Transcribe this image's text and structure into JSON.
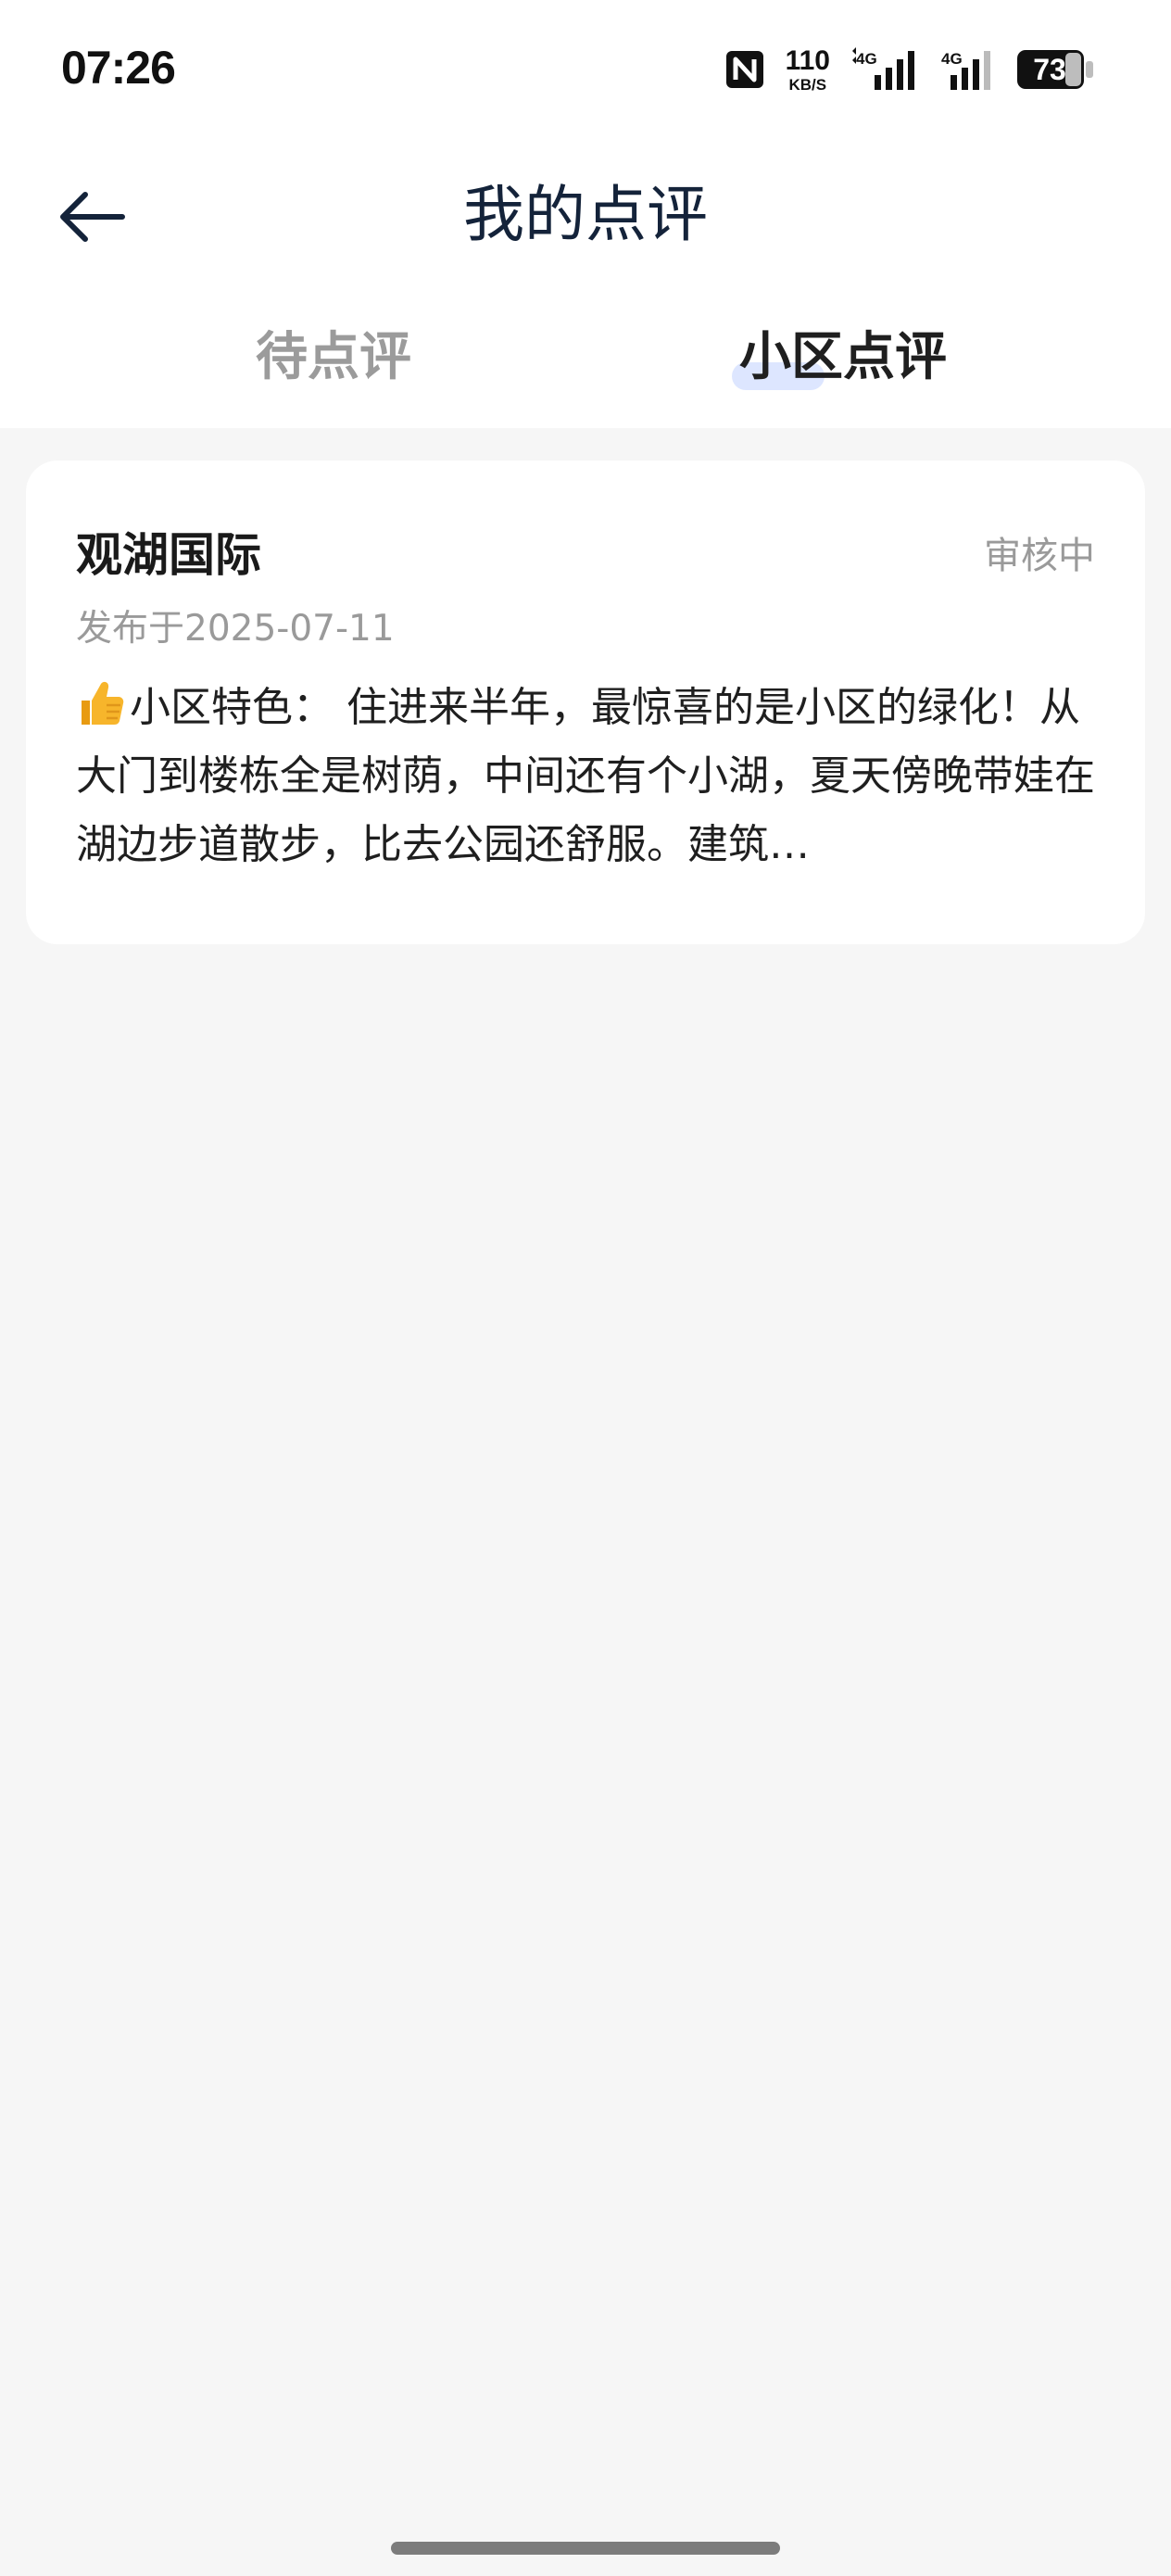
{
  "status_bar": {
    "time": "07:26",
    "net_speed_value": "110",
    "net_speed_unit": "KB/S",
    "signal_1_label": "4G",
    "signal_2_label": "4G",
    "battery_level": "73",
    "icons": [
      "nfc-icon",
      "signal-icon",
      "signal-icon",
      "battery-icon"
    ]
  },
  "header": {
    "title": "我的点评",
    "back_icon": "arrow-left-icon"
  },
  "tabs": [
    {
      "label": "待点评",
      "active": false
    },
    {
      "label": "小区点评",
      "active": true
    }
  ],
  "colors": {
    "accent_indicator": "#dde6ff",
    "title": "#14233a",
    "muted": "#9a9a9a",
    "background": "#f6f6f6"
  },
  "reviews": [
    {
      "community_name": "观湖国际",
      "status": "审核中",
      "date": "发布于2025-07-11",
      "emoji_icon": "thumbs-up-icon",
      "content": "小区特色： 住进来半年，最惊喜的是小区的绿化！从大门到楼栋全是树荫，中间还有个小湖，夏天傍晚带娃在湖边步道散步，比去公园还舒服。建筑…"
    }
  ]
}
